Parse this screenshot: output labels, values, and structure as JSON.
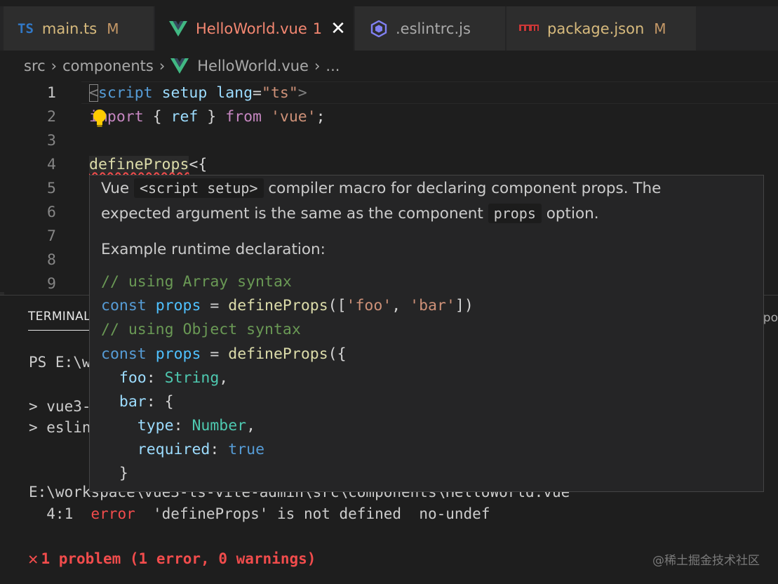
{
  "tabs": [
    {
      "icon": "TS",
      "label": "main.ts",
      "modified": "M"
    },
    {
      "icon": "vue-icon",
      "label": "HelloWorld.vue",
      "errors": "1",
      "active": true
    },
    {
      "icon": "eslint-icon",
      "label": ".eslintrc.js"
    },
    {
      "icon": "npm-icon",
      "label": "package.json",
      "modified": "M"
    }
  ],
  "breadcrumb": {
    "a": "src",
    "b": "components",
    "c": "HelloWorld.vue",
    "d": "..."
  },
  "editor": {
    "line_numbers": [
      "1",
      "2",
      "3",
      "4",
      "5",
      "6",
      "7",
      "8",
      "9"
    ],
    "line1": {
      "lt": "<",
      "tag": "script",
      "sp1": " ",
      "attr1": "setup",
      "sp2": " ",
      "attr2": "lang",
      "eq": "=",
      "val": "\"ts\"",
      "gt": ">"
    },
    "line2": {
      "kw1": "import",
      "p1": " { ",
      "id": "ref",
      "p2": " } ",
      "kw2": "from",
      "sp": " ",
      "str": "'vue'",
      "end": ";"
    },
    "line4": {
      "fn": "defineProps",
      "rest": "<{"
    }
  },
  "hover": {
    "p1a": "Vue ",
    "p1code": "<script setup>",
    "p1b": " compiler macro for declaring component props. The",
    "p2a": "expected argument is the same as the component ",
    "p2code": "props",
    "p2b": " option.",
    "p3": "Example runtime declaration:",
    "c1": "// using Array syntax",
    "c2": {
      "kw": "const",
      "sp": " ",
      "var": "props",
      "eq": " = ",
      "fn": "defineProps",
      "a": "([",
      "s1": "'foo'",
      "comma": ", ",
      "s2": "'bar'",
      "b": "])"
    },
    "c3": "// using Object syntax",
    "c4": {
      "kw": "const",
      "sp": " ",
      "var": "props",
      "eq": " = ",
      "fn": "defineProps",
      "a": "({"
    },
    "c5": {
      "ind": "  ",
      "prop": "foo",
      "colon": ": ",
      "type": "String",
      "end": ","
    },
    "c6": {
      "ind": "  ",
      "prop": "bar",
      "colon": ": ",
      "end": "{"
    },
    "c7": {
      "ind": "    ",
      "prop": "type",
      "colon": ": ",
      "type": "Number",
      "end": ","
    },
    "c8": {
      "ind": "    ",
      "prop": "required",
      "colon": ": ",
      "bool": "true"
    },
    "c9": "  }"
  },
  "panel": {
    "tab": "TERMINAL",
    "right": "po",
    "prompt": "PS E:\\w",
    "l1": "> vue3-",
    "l2": "> eslin",
    "path": "E:\\workspace\\vue3-ts-vite-admin\\src\\components\\HelloWorld.vue",
    "error_line": {
      "pos": "  4:1  ",
      "sev": "error",
      "msg": "  'defineProps' is not defined  no-undef"
    },
    "problem": "1 problem (1 error, 0 warnings)"
  },
  "watermark": "@稀土掘金技术社区",
  "colors": {
    "error": "#f14c4c",
    "modified": "#c49867",
    "vue_green": "#41b883",
    "ts_blue": "#3178c6"
  }
}
